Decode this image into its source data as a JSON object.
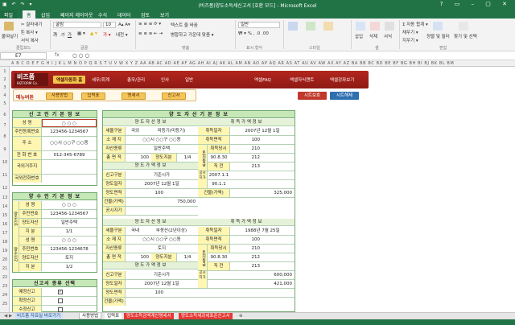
{
  "window": {
    "title": "(비즈폼)양도소득세신고서 [호환 모드] - Microsoft Excel",
    "quick_access": "▣ ↶ ↷ ▾"
  },
  "ribbon_tabs": [
    "파일",
    "홈",
    "삽입",
    "페이지 레이아웃",
    "수식",
    "데이터",
    "검토",
    "보기"
  ],
  "ribbon": {
    "paste": "붙여넣기",
    "cut": "✂ 잘라내기",
    "copy": "⎘ 복사 ▾",
    "format_painter": "서식 복사",
    "clipboard": "클립보드",
    "font_name": "굴림",
    "font_size": "10",
    "font_group": "글꼴",
    "wrap": "텍스트 줄 바꿈",
    "merge": "병합하고 가운데 맞춤 ▾",
    "align_group": "맞춤",
    "number_format": "일반",
    "number_group": "표시 형식",
    "styles_group": "스타일",
    "insert": "삽입",
    "delete": "삭제",
    "format": "서식",
    "cells_group": "셀",
    "autosum": "Σ 자동 합계 ▾",
    "fill": "채우기 ▾",
    "clear": "지우기 ▾",
    "sort": "정렬 및 필터",
    "find": "찾기 및 선택",
    "edit_group": "편집"
  },
  "formula_bar": {
    "name_box": "E7",
    "fx": "fx",
    "value": "○ ○ ○"
  },
  "columns": "A B C D E F G H I J K L M N O P Q R S T U V W X Y Z AA AB AC AD AE AF AG AH AI AJ AK AL AM AN AO AP AQ AR AS AT AU AV AW AX AY AZ BA BB BC BD BE BF BG BH BI BJ BK BL BM",
  "rows": [
    "1",
    "2",
    "3",
    "4",
    "5",
    "6",
    "7",
    "8",
    "9",
    "10",
    "11",
    "12",
    "13",
    "14",
    "15",
    "16",
    "17",
    "18",
    "19",
    "20",
    "21",
    "22",
    "23",
    "24",
    "25",
    "26",
    "27"
  ],
  "banner": {
    "logo": "비즈폼",
    "logo_sub": "BIZFORM Co.",
    "nav": [
      "엑셀자동화 홈",
      "세무/회계",
      "총무/관리",
      "인사",
      "일반"
    ],
    "nav_right": [
      "엑셀FAQ",
      "엑셀자식캔트",
      "엑셀강좌보기"
    ]
  },
  "menu": {
    "label": "메뉴버튼",
    "buttons": [
      "사용방법",
      "입력표",
      "명세서",
      "신고서"
    ],
    "protect": "시트보호",
    "unprotect": "시트해제"
  },
  "reporter": {
    "title": "신 고 인 기 본 정 보",
    "rows": [
      {
        "label": "성   명",
        "value": "○ ○ ○"
      },
      {
        "label": "주민등록번호",
        "value": "123456-1234567"
      },
      {
        "label": "주   소",
        "value": "○○시 ○○구 ○○동"
      },
      {
        "label": "전 화 번 호",
        "value": "012-345-6789"
      },
      {
        "label": "국외거주지",
        "value": ""
      },
      {
        "label": "국외전화번호",
        "value": ""
      }
    ]
  },
  "seller": {
    "title": "양 수 인 기 본 정 보",
    "group1": "양수인1",
    "group2": "양수인2",
    "rows1": [
      {
        "label": "성   명",
        "value": "○ ○ ○"
      },
      {
        "label": "주민번호",
        "value": "123456-1234567"
      },
      {
        "label": "양도자산",
        "value": "일반주택"
      },
      {
        "label": "지   분",
        "value": "1/1"
      }
    ],
    "rows2": [
      {
        "label": "성   명",
        "value": "○ ○ ○"
      },
      {
        "label": "주민번호",
        "value": "123456-1234678"
      },
      {
        "label": "양도자산",
        "value": "토지"
      },
      {
        "label": "지   분",
        "value": "1/2"
      }
    ]
  },
  "kind": {
    "title": "신고서 종류 선택",
    "rows": [
      {
        "label": "예정신고",
        "checked": "✓"
      },
      {
        "label": "확정신고",
        "checked": ""
      },
      {
        "label": "수정신고",
        "checked": ""
      }
    ]
  },
  "asset": {
    "title": "양 도 자 산 기 본 정 보",
    "block1": {
      "head_left": "양 도 자 산 정 보",
      "head_right": "취 득 가 액 정 보",
      "r1": {
        "l1": "세율구분",
        "v1": "국외",
        "v2": "미등기(미등기)",
        "l2": "취득일자",
        "v3": "2007년 12월 1일"
      },
      "r2": {
        "l1": "소 재 지",
        "v1": "○○시 ○○구 ○○동",
        "l2": "취득면적",
        "v3": "100"
      },
      "r3": {
        "l1": "자산종류",
        "v1": "일반주택",
        "l2": "취득당시",
        "v3": "210"
      },
      "r4": {
        "l1": "총 면 적",
        "v1": "100",
        "l2b": "양도지분",
        "v2": "1/4",
        "l2": "취득당시",
        "v3": "90.8.30",
        "l3": "212"
      },
      "sub": "양 도 가 액 정 보",
      "side": "토지등급",
      "r5": {
        "l1": "",
        "l2": "직   전",
        "v3": "213"
      },
      "r6": {
        "l1": "신고구분",
        "v1": "기준시가",
        "l2": "공시지가",
        "v3": "2007.1.1"
      },
      "r7": {
        "l1": "양도일자",
        "v1": "2007년 12월 1일",
        "l2": "",
        "v3": "90.1.1"
      },
      "r8": {
        "l1": "양도면적",
        "v1": "100",
        "l2": "건물(가액)",
        "v3": "325,000"
      },
      "r9": {
        "l1": "건물(가액)",
        "v1": "750,000"
      },
      "r10": {
        "l1": "공시지가",
        "v1": ""
      }
    },
    "block2": {
      "head_left": "양 도 자 산 정 보",
      "head_right": "취 득 가 액 정 보",
      "r1": {
        "l1": "세율구분",
        "v1": "국내",
        "v2": "부동산(2년이상)",
        "l2": "취득일자",
        "v3": "1988년 7월 25일"
      },
      "r2": {
        "l1": "소 재 지",
        "v1": "○○시 ○○구 ○○동",
        "l2": "취득면적",
        "v3": "100"
      },
      "r3": {
        "l1": "자산종류",
        "v1": "토지",
        "l2": "취득당시",
        "v3": "210"
      },
      "r4": {
        "l1": "총 면 적",
        "v1": "100",
        "l2b": "양도지분",
        "v2": "1/4",
        "l2": "취득당시",
        "v3": "90.8.30",
        "l3": "212"
      },
      "sub": "양 도 가 액 정 보",
      "r5": {
        "l2": "직   전",
        "v3": "213"
      },
      "r6": {
        "l1": "신고구분",
        "v1": "기준시가",
        "l2": "공시지가",
        "v3": "600,000"
      },
      "r7": {
        "l1": "양도일자",
        "v1": "2007년 12월 1일",
        "l2": "",
        "v3": "421,000"
      },
      "r8": {
        "l1": "양도면적",
        "v1": "100"
      },
      "r9": {
        "l1": "건물(가액)",
        "v1": ""
      }
    }
  },
  "sheet_tabs": [
    "비즈폼 자료실 바로가기",
    "사용방법",
    "입력표",
    "양도소득금액계산명세서",
    "양도소득세과세표준신고서",
    "⊕"
  ],
  "colors": {
    "excel_green": "#217346",
    "banner_red": "#b3261e",
    "panel_green": "#6fa86f",
    "label_yellow": "#fff6b2",
    "header_green": "#c6e7b6"
  }
}
